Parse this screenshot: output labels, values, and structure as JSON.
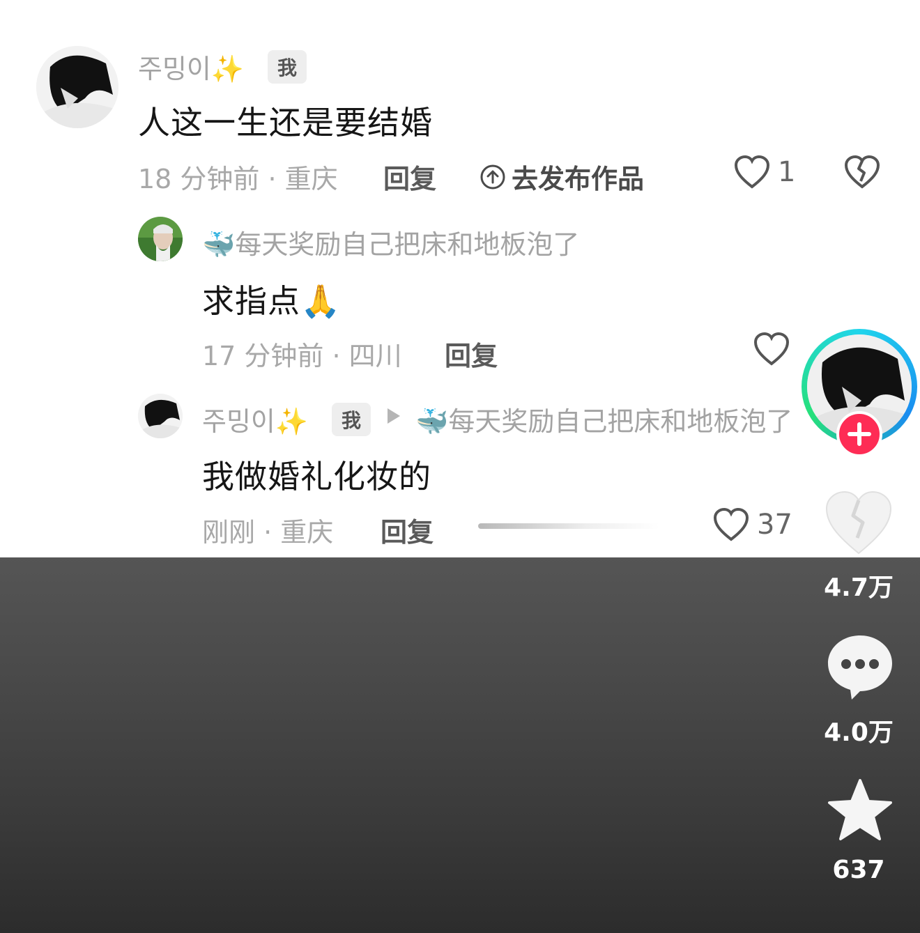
{
  "comments": [
    {
      "user": "주밍이",
      "user_emoji": "✨",
      "me_tag": "我",
      "text": "人这一生还是要结婚",
      "time_location": "18 分钟前 · 重庆",
      "reply_label": "回复",
      "publish_label": "去发布作品",
      "likes": "1"
    },
    {
      "user_emoji": "🐳",
      "user": "每天奖励自己把床和地板泡了",
      "text": "求指点",
      "text_emoji": "🙏",
      "time_location": "17 分钟前 · 四川",
      "reply_label": "回复"
    },
    {
      "user": "주밍이",
      "user_emoji": "✨",
      "me_tag": "我",
      "reply_to_emoji": "🐳",
      "reply_to": "每天奖励自己把床和地板泡了",
      "text": "我做婚礼化妆的",
      "time_location": "刚刚 · 重庆",
      "reply_label": "回复",
      "likes": "37"
    }
  ],
  "sidebar": {
    "like_count": "4.7万",
    "comment_count": "4.0万",
    "favorite_count": "637"
  },
  "icons": [
    "heart-icon",
    "broken-heart-icon",
    "upload-icon",
    "comment-icon",
    "star-icon",
    "follow-plus-icon"
  ],
  "colors": {
    "follow_plus": "#fe2c55",
    "ring_start": "#20d5ec",
    "ring_end": "#26e07a"
  }
}
